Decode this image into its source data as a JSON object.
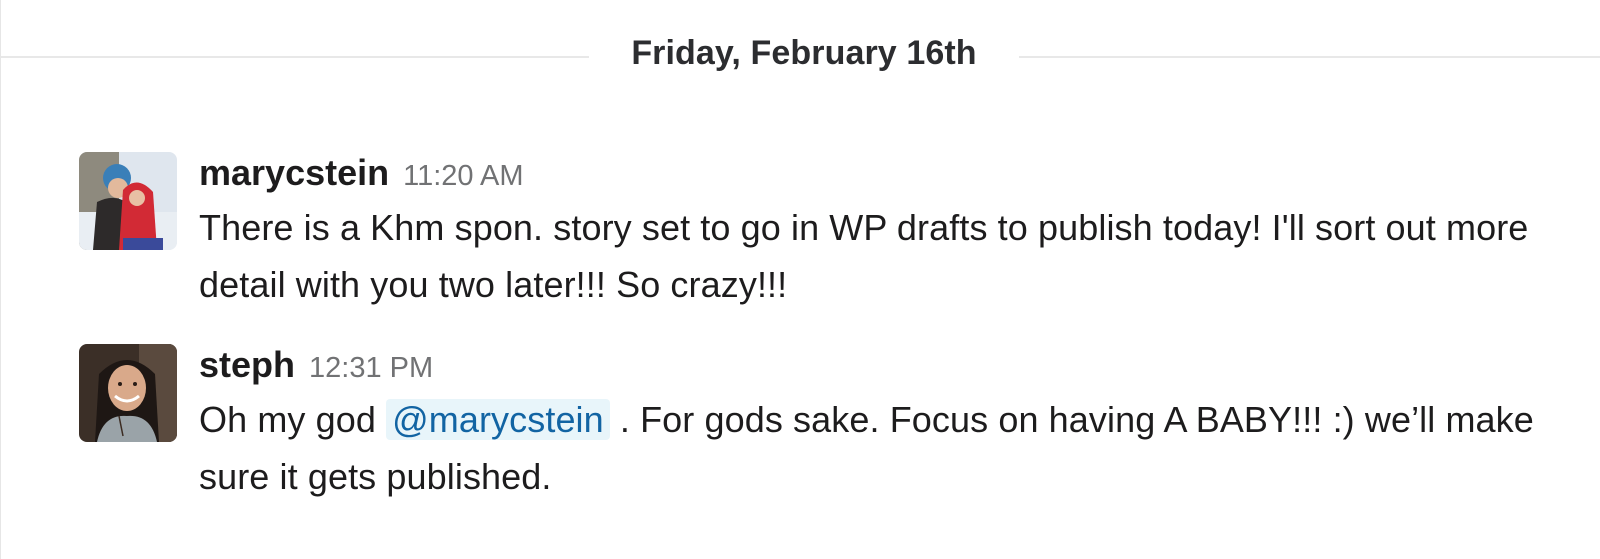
{
  "day_divider": {
    "label": "Friday, February 16th"
  },
  "messages": [
    {
      "sender": "marycstein",
      "time": "11:20 AM",
      "text": "There is a Khm spon. story set to go in WP drafts to publish today! I'll sort out more detail with you two later!!! So crazy!!!"
    },
    {
      "sender": "steph",
      "time": "12:31 PM",
      "text_before": "Oh my god ",
      "mention": "@marycstein",
      "text_after": " . For gods sake. Focus on having A BABY!!! :) we’ll make sure it gets published."
    }
  ]
}
